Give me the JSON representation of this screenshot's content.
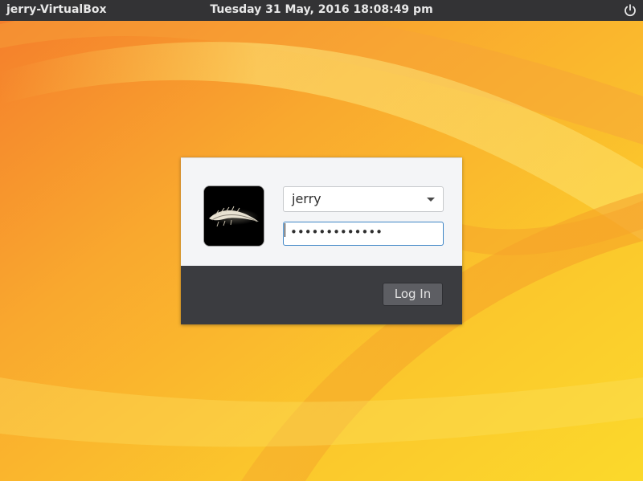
{
  "top_panel": {
    "hostname": "jerry-VirtualBox",
    "clock": "Tuesday 31 May, 2016 18:08:49 pm",
    "power_icon": "power-icon"
  },
  "login": {
    "avatar_icon": "feather-avatar",
    "user_select": {
      "selected": "jerry"
    },
    "password": {
      "masked_value": "•••••••••••••"
    },
    "login_button_label": "Log In"
  },
  "colors": {
    "panel_bg": "#333335",
    "dialog_top_bg": "#f4f5f7",
    "dialog_bottom_bg": "#3b3c40",
    "focus_border": "#3f86c6",
    "wallpaper_orange": "#f58a2a",
    "wallpaper_yellow": "#fbd92c"
  }
}
